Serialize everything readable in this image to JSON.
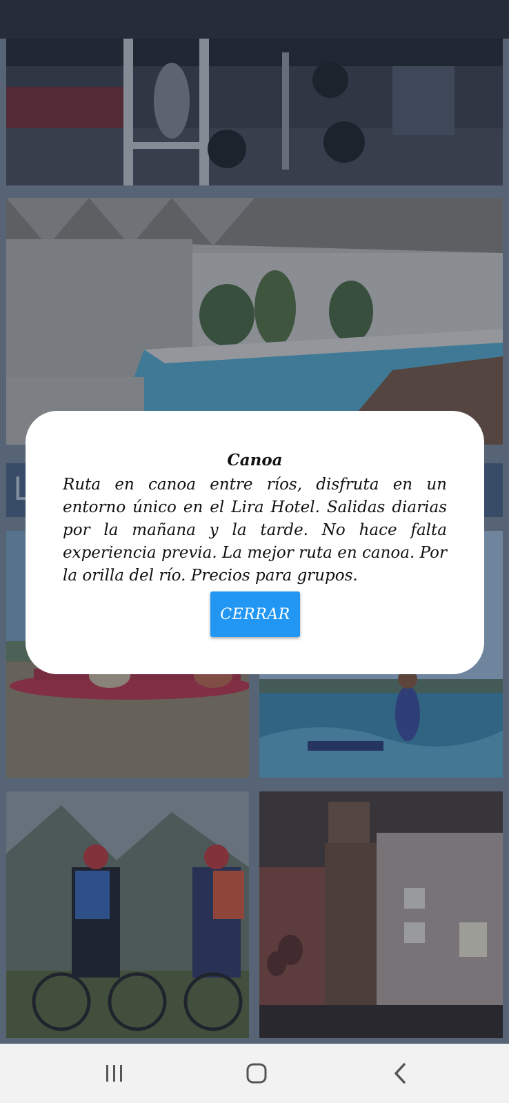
{
  "dialog": {
    "title": "Canoa",
    "body": "Ruta en canoa entre ríos, disfruta en un entorno único en el Lira Hotel. Salidas diarias por la mañana y la tarde. No hace falta experiencia previa. La mejor ruta en canoa. Por la orilla del río. Precios para grupos.",
    "close_label": "CERRAR"
  },
  "section": {
    "heading_fragment": "L"
  },
  "photos": [
    "gym",
    "indoor-pool",
    "canoe",
    "kitesurf",
    "bike-tour",
    "museum"
  ],
  "icons": {
    "recents": "recents-icon",
    "home": "home-icon",
    "back": "back-icon"
  },
  "colors": {
    "button": "#2196f3",
    "section_bar": "#4a6687",
    "nav_bar": "#f2f2f2"
  }
}
